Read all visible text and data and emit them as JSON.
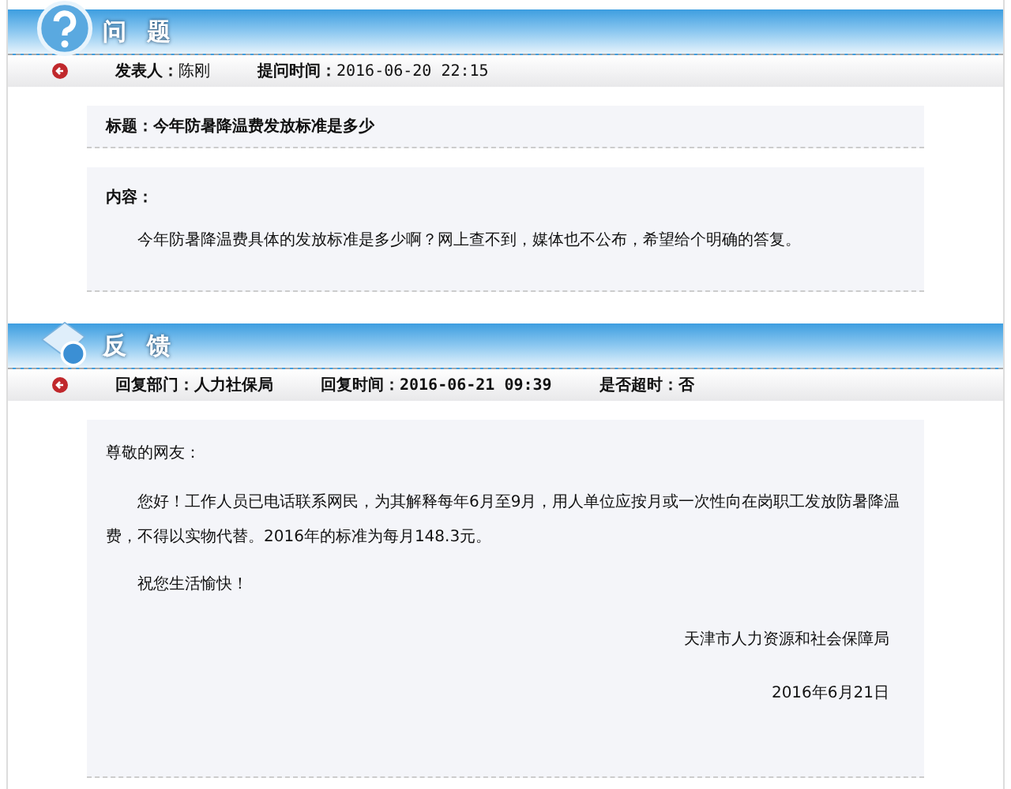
{
  "question": {
    "title": "问 题",
    "meta": [
      {
        "label": "发表人：",
        "value": "陈刚"
      },
      {
        "label": "提问时间：",
        "value": "2016-06-20 22:15"
      }
    ],
    "subject": "标题：今年防暑降温费发放标准是多少",
    "content_label": "内容：",
    "content": "今年防暑降温费具体的发放标准是多少啊？网上查不到，媒体也不公布，希望给个明确的答复。"
  },
  "feedback": {
    "title": "反 馈",
    "meta": [
      {
        "label": "回复部门：",
        "value": "人力社保局"
      },
      {
        "label": "回复时间：",
        "value": "2016-06-21 09:39"
      },
      {
        "label": "是否超时：",
        "value": "否"
      }
    ],
    "greeting": "尊敬的网友：",
    "paragraphs": [
      "您好！工作人员已电话联系网民，为其解释每年6月至9月，用人单位应按月或一次性向在岗职工发放防暑降温费，不得以实物代替。2016年的标准为每月148.3元。",
      "祝您生活愉快！"
    ],
    "signature": "天津市人力资源和社会保障局",
    "date": "2016年6月21日"
  }
}
